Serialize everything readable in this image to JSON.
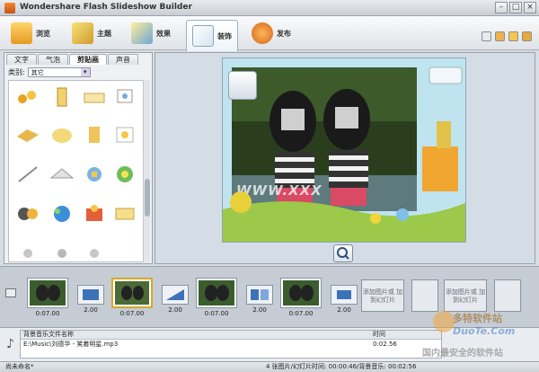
{
  "window": {
    "title": "Wondershare Flash Slideshow Builder"
  },
  "toolbar": {
    "items": [
      {
        "label": "浏览"
      },
      {
        "label": "主题"
      },
      {
        "label": "效果"
      },
      {
        "label": "装饰"
      },
      {
        "label": "发布"
      }
    ],
    "active": "装饰"
  },
  "panel": {
    "tabs": [
      "文字",
      "气泡",
      "剪贴画",
      "声音"
    ],
    "active_tab": "剪贴画",
    "category_label": "类别:",
    "category_value": "其它"
  },
  "preview": {
    "watermark": "WWW.XXX"
  },
  "storyboard": {
    "clips": [
      {
        "duration": "0:07.00"
      },
      {
        "duration": "0:07.00"
      },
      {
        "duration": "0:07.00"
      },
      {
        "duration": "0:07.00"
      }
    ],
    "transitions": [
      {
        "duration": "2.00"
      },
      {
        "duration": "2.00"
      },
      {
        "duration": "2.00"
      },
      {
        "duration": "2.00"
      }
    ],
    "empty_label": "添加图片或\n加到幻灯片"
  },
  "music": {
    "col_name": "背景音乐文件名称",
    "col_time": "时间",
    "file": "E:\\Music\\刘德华 - 笑着明星.mp3",
    "time": "0:02.56"
  },
  "status": {
    "left": "尚未命名*",
    "right": "4 张图片/幻灯片时间: 00:00:46/背景音乐: 00:02:56"
  },
  "brand": {
    "line1": "多特软件站",
    "line2": "DuoTe.Com",
    "line3": "国内最安全的软件站"
  }
}
